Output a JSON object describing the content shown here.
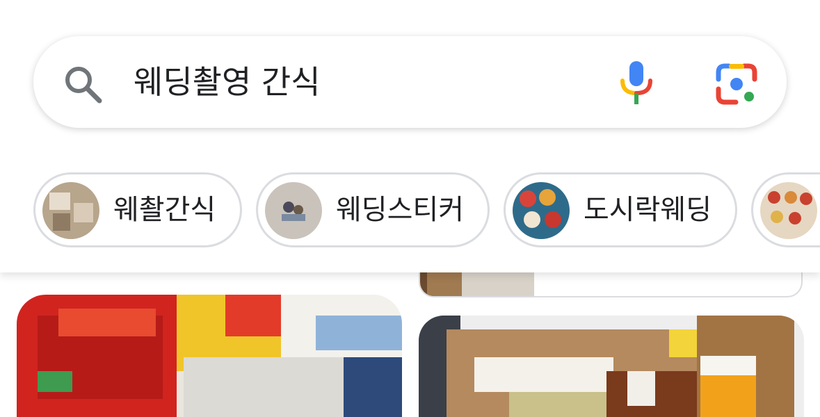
{
  "search": {
    "query": "웨딩촬영 간식"
  },
  "icons": {
    "search": "search-icon",
    "voice": "mic-icon",
    "lens": "camera-lens-icon"
  },
  "chips": [
    {
      "label": "웨촬간식"
    },
    {
      "label": "웨딩스티커"
    },
    {
      "label": "도시락웨딩"
    },
    {
      "label": ""
    }
  ],
  "colors": {
    "google_blue": "#4285F4",
    "google_red": "#EA4335",
    "google_yellow": "#FBBC05",
    "google_green": "#34A853",
    "chip_border": "#dadce0",
    "text": "#202124"
  }
}
